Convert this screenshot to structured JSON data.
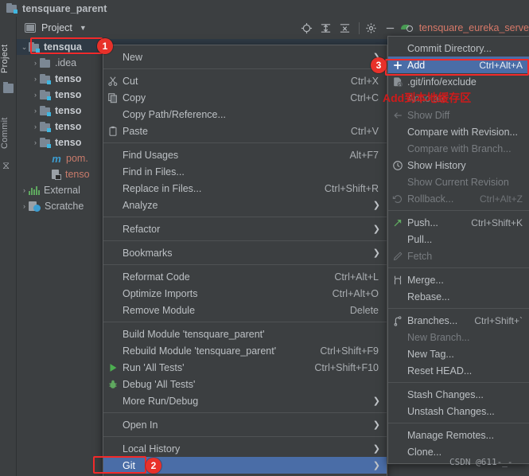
{
  "window": {
    "title": "tensquare_parent"
  },
  "toolwindow_strip": {
    "tabs": [
      "Project",
      "Commit"
    ]
  },
  "panel": {
    "title": "Project",
    "toolbar": {
      "icons": [
        "locate-icon",
        "expand-all-icon",
        "collapse-all-icon",
        "settings-gear-icon",
        "hide-icon"
      ],
      "run_config": "tensquare_eureka_serve"
    }
  },
  "tree": {
    "items": [
      {
        "label": "tensqua",
        "icon": "module-folder-icon",
        "arrow": "⌄",
        "selected": true,
        "bold": true,
        "indent": 4
      },
      {
        "label": ".idea",
        "icon": "folder-icon",
        "arrow": "›",
        "selected": false,
        "bold": false,
        "indent": 18
      },
      {
        "label": "tenso",
        "icon": "module-folder-icon",
        "arrow": "›",
        "selected": false,
        "bold": true,
        "indent": 18
      },
      {
        "label": "tenso",
        "icon": "module-folder-icon",
        "arrow": "›",
        "selected": false,
        "bold": true,
        "indent": 18
      },
      {
        "label": "tenso",
        "icon": "module-folder-icon",
        "arrow": "›",
        "selected": false,
        "bold": true,
        "indent": 18
      },
      {
        "label": "tenso",
        "icon": "module-folder-icon",
        "arrow": "›",
        "selected": false,
        "bold": true,
        "indent": 18
      },
      {
        "label": "tenso",
        "icon": "module-folder-icon",
        "arrow": "›",
        "selected": false,
        "bold": true,
        "indent": 18
      },
      {
        "label": "pom.",
        "icon": "maven-pom-icon",
        "arrow": "",
        "selected": false,
        "bold": false,
        "indent": 32,
        "color": "red"
      },
      {
        "label": "tenso",
        "icon": "iml-file-icon",
        "arrow": "",
        "selected": false,
        "bold": false,
        "indent": 32,
        "color": "red"
      },
      {
        "label": "External",
        "icon": "library-icon",
        "arrow": "›",
        "selected": false,
        "bold": false,
        "indent": 4
      },
      {
        "label": "Scratche",
        "icon": "scratches-icon",
        "arrow": "›",
        "selected": false,
        "bold": false,
        "indent": 4
      }
    ]
  },
  "context_menu": {
    "items": [
      {
        "label": "New",
        "key": "",
        "icon": "",
        "submenu": true,
        "state": "normal"
      },
      {
        "sep": true
      },
      {
        "label": "Cut",
        "mnemonic": "t",
        "key": "Ctrl+X",
        "icon": "scissors-icon",
        "submenu": false,
        "state": "normal"
      },
      {
        "label": "Copy",
        "mnemonic": "C",
        "key": "Ctrl+C",
        "icon": "copy-icon",
        "submenu": false,
        "state": "normal"
      },
      {
        "label": "Copy Path/Reference...",
        "key": "",
        "icon": "",
        "submenu": false,
        "state": "normal"
      },
      {
        "label": "Paste",
        "mnemonic": "P",
        "key": "Ctrl+V",
        "icon": "clipboard-icon",
        "submenu": false,
        "state": "normal"
      },
      {
        "sep": true
      },
      {
        "label": "Find Usages",
        "mnemonic": "U",
        "key": "Alt+F7",
        "icon": "",
        "submenu": false,
        "state": "normal"
      },
      {
        "label": "Find in Files...",
        "key": "",
        "icon": "",
        "submenu": false,
        "state": "normal"
      },
      {
        "label": "Replace in Files...",
        "mnemonic": "l",
        "key": "Ctrl+Shift+R",
        "icon": "",
        "submenu": false,
        "state": "normal"
      },
      {
        "label": "Analyze",
        "mnemonic": "z",
        "key": "",
        "icon": "",
        "submenu": true,
        "state": "normal"
      },
      {
        "sep": true
      },
      {
        "label": "Refactor",
        "mnemonic": "R",
        "key": "",
        "icon": "",
        "submenu": true,
        "state": "normal"
      },
      {
        "sep": true
      },
      {
        "label": "Bookmarks",
        "key": "",
        "icon": "",
        "submenu": true,
        "state": "normal"
      },
      {
        "sep": true
      },
      {
        "label": "Reformat Code",
        "mnemonic": "R",
        "key": "Ctrl+Alt+L",
        "icon": "",
        "submenu": false,
        "state": "normal"
      },
      {
        "label": "Optimize Imports",
        "mnemonic": "z",
        "key": "Ctrl+Alt+O",
        "icon": "",
        "submenu": false,
        "state": "normal"
      },
      {
        "label": "Remove Module",
        "key": "",
        "key2": "Delete",
        "icon": "",
        "submenu": false,
        "state": "normal"
      },
      {
        "sep": true
      },
      {
        "label": "Build Module 'tensquare_parent'",
        "mnemonic": "M",
        "key": "",
        "icon": "",
        "submenu": false,
        "state": "normal"
      },
      {
        "label": "Rebuild Module 'tensquare_parent'",
        "mnemonic": "e",
        "key": "Ctrl+Shift+F9",
        "icon": "",
        "submenu": false,
        "state": "normal"
      },
      {
        "label": "Run 'All Tests'",
        "mnemonic": "u",
        "key": "Ctrl+Shift+F10",
        "icon": "run-play-icon",
        "submenu": false,
        "state": "normal"
      },
      {
        "label": "Debug 'All Tests'",
        "mnemonic": "D",
        "key": "",
        "icon": "debug-bug-icon",
        "submenu": false,
        "state": "normal"
      },
      {
        "label": "More Run/Debug",
        "key": "",
        "icon": "",
        "submenu": true,
        "state": "normal"
      },
      {
        "sep": true
      },
      {
        "label": "Open In",
        "key": "",
        "icon": "",
        "submenu": true,
        "state": "normal"
      },
      {
        "sep": true
      },
      {
        "label": "Local History",
        "mnemonic": "H",
        "key": "",
        "icon": "",
        "submenu": true,
        "state": "normal"
      },
      {
        "label": "Git",
        "mnemonic": "G",
        "key": "",
        "icon": "",
        "submenu": true,
        "state": "selected"
      }
    ]
  },
  "git_menu": {
    "items": [
      {
        "label": "Commit Directory...",
        "mnemonic": "it",
        "key": "",
        "icon": "",
        "state": "normal"
      },
      {
        "label": "Add",
        "key": "Ctrl+Alt+A",
        "icon": "plus-icon",
        "state": "selected"
      },
      {
        "label": ".git/info/exclude",
        "key": "",
        "icon": "ignore-file-icon",
        "state": "normal"
      },
      {
        "label": "Annotate",
        "mnemonic": "A",
        "key": "",
        "icon": "",
        "state": "disabled"
      },
      {
        "label": "Show Diff",
        "key": "",
        "icon": "diff-icon",
        "state": "disabled"
      },
      {
        "label": "Compare with Revision...",
        "mnemonic": "C",
        "key": "",
        "icon": "",
        "state": "normal"
      },
      {
        "label": "Compare with Branch...",
        "key": "",
        "icon": "",
        "state": "disabled"
      },
      {
        "label": "Show History",
        "mnemonic": "H",
        "key": "",
        "icon": "history-clock-icon",
        "state": "normal"
      },
      {
        "label": "Show Current Revision",
        "key": "",
        "icon": "",
        "state": "disabled"
      },
      {
        "label": "Rollback...",
        "mnemonic": "R",
        "key": "Ctrl+Alt+Z",
        "icon": "rollback-icon",
        "state": "disabled"
      },
      {
        "sep": true
      },
      {
        "label": "Push...",
        "key": "Ctrl+Shift+K",
        "icon": "push-arrow-icon",
        "state": "normal"
      },
      {
        "label": "Pull...",
        "key": "",
        "icon": "",
        "state": "normal"
      },
      {
        "label": "Fetch",
        "key": "",
        "icon": "fetch-icon",
        "state": "disabled"
      },
      {
        "sep": true
      },
      {
        "label": "Merge...",
        "key": "",
        "icon": "merge-icon",
        "state": "normal"
      },
      {
        "label": "Rebase...",
        "key": "",
        "icon": "",
        "state": "normal"
      },
      {
        "sep": true
      },
      {
        "label": "Branches...",
        "mnemonic": "B",
        "key": "Ctrl+Shift+`",
        "icon": "branch-icon",
        "state": "normal"
      },
      {
        "label": "New Branch...",
        "key": "",
        "icon": "",
        "state": "disabled"
      },
      {
        "label": "New Tag...",
        "key": "",
        "icon": "",
        "state": "normal"
      },
      {
        "label": "Reset HEAD...",
        "key": "",
        "icon": "",
        "state": "normal"
      },
      {
        "sep": true
      },
      {
        "label": "Stash Changes...",
        "key": "",
        "icon": "",
        "state": "normal"
      },
      {
        "label": "Unstash Changes...",
        "key": "",
        "icon": "",
        "state": "normal"
      },
      {
        "sep": true
      },
      {
        "label": "Manage Remotes...",
        "key": "",
        "icon": "",
        "state": "normal"
      },
      {
        "label": "Clone...",
        "key": "",
        "icon": "",
        "state": "normal"
      }
    ]
  },
  "annotations": {
    "badge1": "1",
    "badge2": "2",
    "badge3": "3",
    "note": "Add到本地缓存区",
    "watermark": "CSDN @611-_-"
  },
  "colors": {
    "menu_bg": "#3c3f41",
    "menu_selected": "#4a6da7",
    "annotation_red": "#f12a2a",
    "accent_blue": "#40b6e0",
    "tree_selected": "#2f3a45"
  }
}
